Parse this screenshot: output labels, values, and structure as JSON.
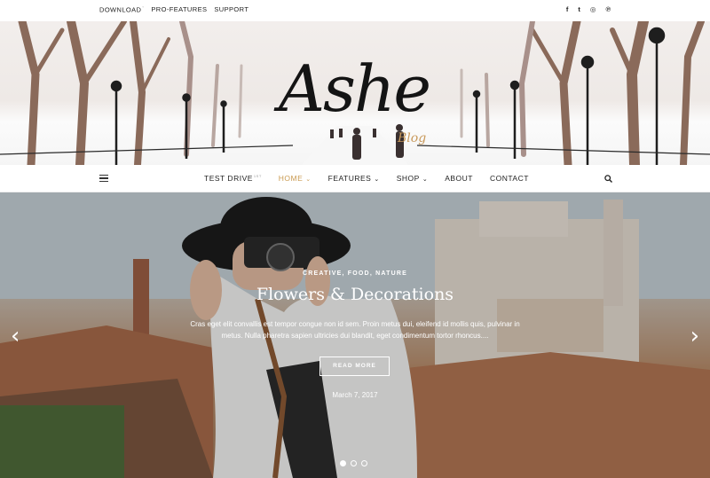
{
  "topbar": {
    "links": [
      {
        "label": "DOWNLOAD",
        "badge": "°"
      },
      {
        "label": "PRO-FEATURES"
      },
      {
        "label": "SUPPORT"
      }
    ],
    "social_icons": [
      "facebook-icon",
      "twitter-icon",
      "instagram-icon",
      "pinterest-icon"
    ],
    "social_glyphs": [
      "f",
      "t",
      "◎",
      "℗"
    ]
  },
  "header": {
    "logo_text": "Ashe",
    "logo_sub": "Blog"
  },
  "nav": {
    "items": [
      {
        "label": "TEST DRIVE",
        "badge": "1ST",
        "active": false,
        "caret": false
      },
      {
        "label": "HOME",
        "active": true,
        "caret": true
      },
      {
        "label": "FEATURES",
        "active": false,
        "caret": true
      },
      {
        "label": "SHOP",
        "active": false,
        "caret": true
      },
      {
        "label": "ABOUT",
        "active": false,
        "caret": false
      },
      {
        "label": "CONTACT",
        "active": false,
        "caret": false
      }
    ],
    "caret_glyph": "⌄"
  },
  "slide": {
    "categories": "CREATIVE, FOOD, NATURE",
    "title": "Flowers & Decorations",
    "excerpt": "Cras eget elit convallis est tempor congue non id sem. Proin metus dui, eleifend id mollis quis, pulvinar in metus. Nulla pharetra sapien ultricies dui blandit, eget condimentum tortor rhoncus....",
    "read_more": "READ MORE",
    "date": "March 7, 2017",
    "prev_glyph": "‹",
    "next_glyph": "›",
    "dots": 3,
    "active_dot": 0
  },
  "colors": {
    "accent": "#ca9b52",
    "text": "#222222"
  }
}
